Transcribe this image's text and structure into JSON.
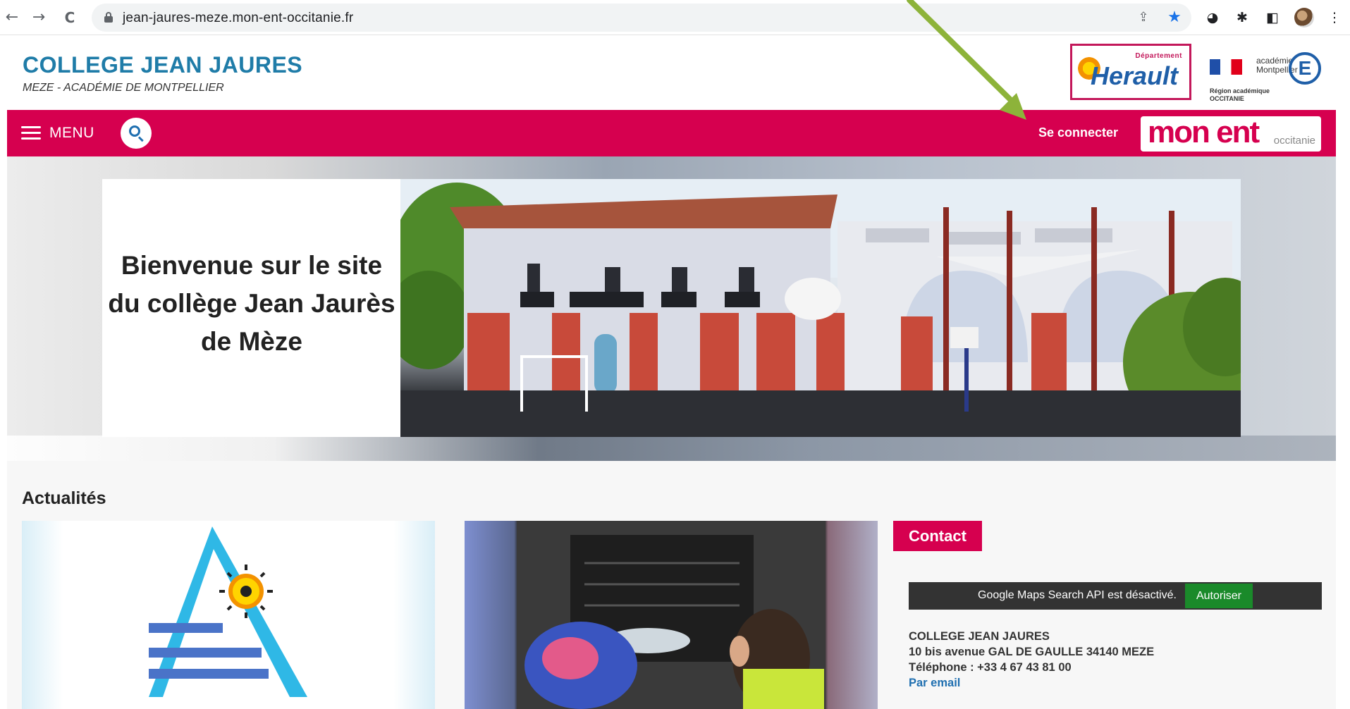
{
  "browser": {
    "url": "jean-jaures-meze.mon-ent-occitanie.fr",
    "back_icon": "←",
    "forward_icon": "→",
    "reload_icon": "C",
    "share_icon": "⇪",
    "bookmark_icon": "★",
    "extension_icon": "✱",
    "sidebar_icon": "◧",
    "menu_icon": "⋮"
  },
  "header": {
    "title": "COLLEGE JEAN JAURES",
    "subtitle": "MEZE - ACADÉMIE DE MONTPELLIER",
    "herault_logo": {
      "dept": "Département",
      "name": "Herault"
    },
    "region_logo": {
      "acad_line1": "académie",
      "acad_line2": "Montpellier",
      "e_letter": "E",
      "region_line1": "Région académique",
      "region_line2": "OCCITANIE"
    }
  },
  "navbar": {
    "menu_label": "MENU",
    "login_label": "Se connecter",
    "ent_logo_main": "mon ent",
    "ent_logo_sub": "occitanie"
  },
  "hero": {
    "welcome_text": "Bienvenue sur le site du collège Jean Jaurès de Mèze"
  },
  "news": {
    "title": "Actualités"
  },
  "contact": {
    "badge": "Contact",
    "maps_notice": "Google Maps Search API est désactivé.",
    "maps_button": "Autoriser",
    "name": "COLLEGE JEAN JAURES",
    "street": "10 bis avenue GAL DE GAULLE 34140 MEZE",
    "phone": "Téléphone : +33 4 67 43 81 00",
    "email_link": "Par email"
  },
  "colors": {
    "brand_magenta": "#d6004f",
    "title_blue": "#1f7ca8",
    "arrow_green": "#8db33a",
    "maps_green": "#1a8a2a"
  }
}
